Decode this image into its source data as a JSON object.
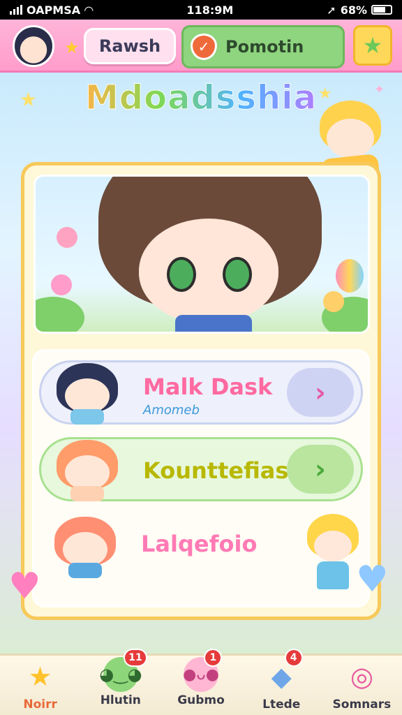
{
  "status_bar": {
    "carrier": "OAPMSA",
    "time": "118:9M",
    "battery": "68%"
  },
  "header": {
    "rawsh_label": "Rawsh",
    "pomotin_label": "Pomotin"
  },
  "app_title": "Mdoadsshia",
  "list": {
    "items": [
      {
        "title": "Malk Dask",
        "subtitle": "Amomeb",
        "title_color": "#ff6aa0",
        "arrow": "›"
      },
      {
        "title": "Kounttefias",
        "subtitle": "",
        "title_color": "#b8b800",
        "arrow": "›"
      },
      {
        "title": "Lalqefoio",
        "subtitle": "",
        "title_color": "#ff7ab5",
        "arrow": ""
      }
    ]
  },
  "bottom_nav": {
    "items": [
      {
        "label": "Noirr",
        "badge": "",
        "icon": "star-icon",
        "active": true
      },
      {
        "label": "Hlutin",
        "badge": "11",
        "icon": "frog-icon",
        "active": false
      },
      {
        "label": "Gubmo",
        "badge": "1",
        "icon": "character-icon",
        "active": false
      },
      {
        "label": "Ltede",
        "badge": "4",
        "icon": "crystal-icon",
        "active": false
      },
      {
        "label": "Somnars",
        "badge": "",
        "icon": "target-icon",
        "active": false
      }
    ]
  },
  "colors": {
    "header_pink": "#ff9ccb",
    "accent_green": "#8fd47e",
    "panel_yellow": "#f7c95a",
    "badge_red": "#e63b3b"
  }
}
